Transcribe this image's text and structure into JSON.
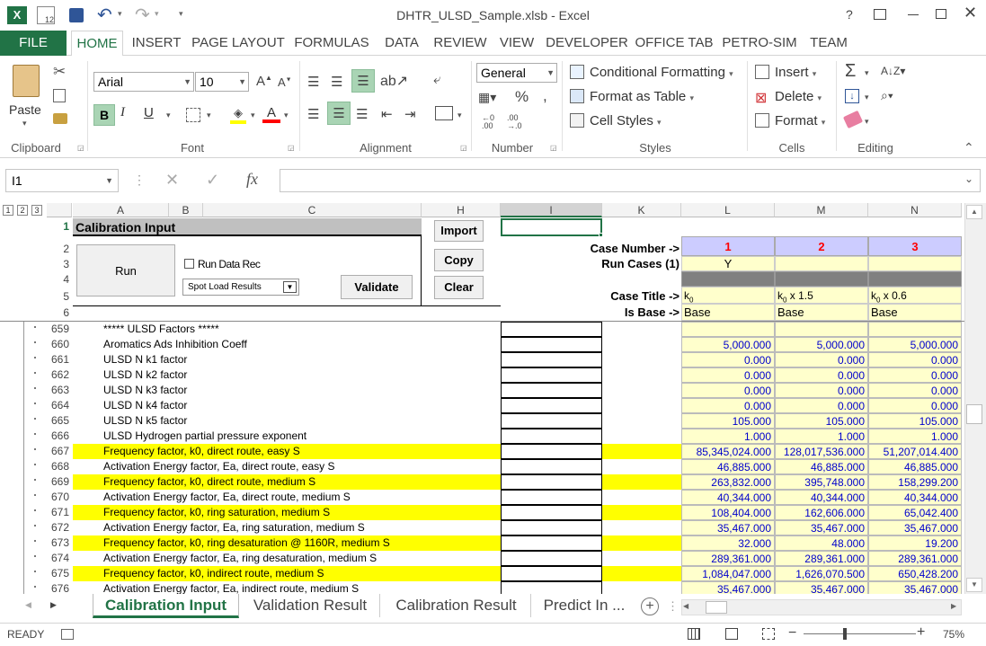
{
  "window": {
    "title": "DHTR_ULSD_Sample.xlsb - Excel",
    "help": "?"
  },
  "ribbon_tabs": [
    "FILE",
    "HOME",
    "INSERT",
    "PAGE LAYOUT",
    "FORMULAS",
    "DATA",
    "REVIEW",
    "VIEW",
    "DEVELOPER",
    "OFFICE TAB",
    "PETRO-SIM",
    "TEAM"
  ],
  "ribbon": {
    "paste": "Paste",
    "font_name": "Arial",
    "font_size": "10",
    "number_format": "General",
    "conditional": "Conditional Formatting",
    "format_table": "Format as Table",
    "cell_styles": "Cell Styles",
    "insert": "Insert",
    "delete": "Delete",
    "format": "Format",
    "groups": [
      "Clipboard",
      "Font",
      "Alignment",
      "Number",
      "Styles",
      "Cells",
      "Editing"
    ],
    "bold": "B",
    "italic": "I",
    "underline": "U"
  },
  "formula_bar": {
    "name_box": "I1",
    "fx": "fx",
    "formula": ""
  },
  "outline_levels": [
    "1",
    "2",
    "3"
  ],
  "columns": [
    "A",
    "B",
    "C",
    "H",
    "I",
    "K",
    "L",
    "M",
    "N"
  ],
  "top_panel": {
    "title": "Calibration Input",
    "run": "Run",
    "run_data_rec": "Run Data Rec",
    "spot_load": "Spot Load Results",
    "validate": "Validate",
    "import": "Import",
    "copy": "Copy",
    "clear": "Clear",
    "case_number": "Case Number ->",
    "run_cases": "Run Cases (1)",
    "case_title": "Case Title ->",
    "is_base": "Is Base ->",
    "case_numbers": [
      "1",
      "2",
      "3"
    ],
    "run_flags": [
      "Y",
      "",
      ""
    ],
    "case_titles": [
      "k",
      "k x 1.5",
      "k x 0.6"
    ],
    "case_title_sub": "0",
    "is_base_vals": [
      "Base",
      "Base",
      "Base"
    ],
    "top_rows": [
      "1",
      "2",
      "3",
      "4",
      "5",
      "6"
    ]
  },
  "rows": [
    {
      "n": "659",
      "label": "*****  ULSD Factors  *****",
      "hl": false,
      "v": [
        "",
        "",
        ""
      ]
    },
    {
      "n": "660",
      "label": "Aromatics Ads Inhibition Coeff",
      "hl": false,
      "v": [
        "5,000.000",
        "5,000.000",
        "5,000.000"
      ]
    },
    {
      "n": "661",
      "label": "ULSD N k1 factor",
      "hl": false,
      "v": [
        "0.000",
        "0.000",
        "0.000"
      ]
    },
    {
      "n": "662",
      "label": "ULSD N k2 factor",
      "hl": false,
      "v": [
        "0.000",
        "0.000",
        "0.000"
      ]
    },
    {
      "n": "663",
      "label": "ULSD N k3 factor",
      "hl": false,
      "v": [
        "0.000",
        "0.000",
        "0.000"
      ]
    },
    {
      "n": "664",
      "label": "ULSD N k4 factor",
      "hl": false,
      "v": [
        "0.000",
        "0.000",
        "0.000"
      ]
    },
    {
      "n": "665",
      "label": "ULSD N k5 factor",
      "hl": false,
      "v": [
        "105.000",
        "105.000",
        "105.000"
      ]
    },
    {
      "n": "666",
      "label": "ULSD Hydrogen partial pressure exponent",
      "hl": false,
      "v": [
        "1.000",
        "1.000",
        "1.000"
      ]
    },
    {
      "n": "667",
      "label": "Frequency factor, k0, direct route, easy S",
      "hl": true,
      "v": [
        "85,345,024.000",
        "128,017,536.000",
        "51,207,014.400"
      ]
    },
    {
      "n": "668",
      "label": "Activation Energy factor, Ea, direct route, easy S",
      "hl": false,
      "v": [
        "46,885.000",
        "46,885.000",
        "46,885.000"
      ]
    },
    {
      "n": "669",
      "label": "Frequency factor, k0, direct route, medium S",
      "hl": true,
      "v": [
        "263,832.000",
        "395,748.000",
        "158,299.200"
      ]
    },
    {
      "n": "670",
      "label": "Activation Energy factor, Ea, direct route, medium S",
      "hl": false,
      "v": [
        "40,344.000",
        "40,344.000",
        "40,344.000"
      ]
    },
    {
      "n": "671",
      "label": "Frequency factor, k0, ring saturation, medium S",
      "hl": true,
      "v": [
        "108,404.000",
        "162,606.000",
        "65,042.400"
      ]
    },
    {
      "n": "672",
      "label": "Activation Energy factor, Ea, ring saturation, medium S",
      "hl": false,
      "v": [
        "35,467.000",
        "35,467.000",
        "35,467.000"
      ]
    },
    {
      "n": "673",
      "label": "Frequency factor, k0, ring desaturation @ 1160R, medium S",
      "hl": true,
      "v": [
        "32.000",
        "48.000",
        "19.200"
      ]
    },
    {
      "n": "674",
      "label": "Activation Energy factor, Ea, ring desaturation, medium S",
      "hl": false,
      "v": [
        "289,361.000",
        "289,361.000",
        "289,361.000"
      ]
    },
    {
      "n": "675",
      "label": "Frequency factor, k0, indirect route, medium S",
      "hl": true,
      "v": [
        "1,084,047.000",
        "1,626,070.500",
        "650,428.200"
      ]
    },
    {
      "n": "676",
      "label": "Activation Energy factor, Ea, indirect route, medium S",
      "hl": false,
      "v": [
        "35,467.000",
        "35,467.000",
        "35,467.000"
      ]
    }
  ],
  "sheet_tabs": [
    "Calibration Input",
    "Validation Result",
    "Calibration Result",
    "Predict In ..."
  ],
  "status": {
    "ready": "READY",
    "zoom": "75%"
  },
  "colors": {
    "excel_green": "#217346",
    "highlight": "#ffff00",
    "cream": "#ffffcc",
    "lavender": "#ccccff",
    "blue_text": "#0000cc",
    "red_text": "#ff0000"
  }
}
